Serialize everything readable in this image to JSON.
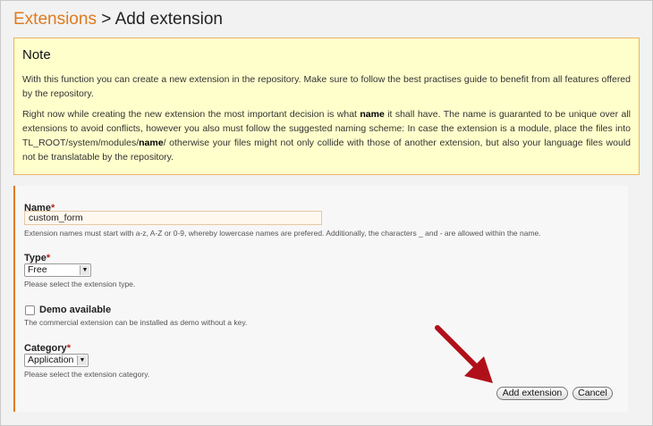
{
  "header": {
    "breadcrumb_link": "Extensions",
    "separator": ">",
    "title": "Add extension"
  },
  "note": {
    "heading": "Note",
    "p1": "With this function you can create a new extension in the repository. Make sure to follow the best practises guide to benefit from all features offered by the repository.",
    "p2_a": "Right now while creating the new extension the most important decision is what ",
    "p2_b": "name",
    "p2_c": " it shall have. The name is guaranted to be unique over all extensions to avoid conflicts, however you also must follow the suggested naming scheme: In case the extension is a module, place the files into TL_ROOT/system/modules/",
    "p2_d": "name",
    "p2_e": "/ otherwise your files might not only collide with those of another extension, but also your language files would not be translatable by the repository."
  },
  "form": {
    "name": {
      "label": "Name",
      "required_mark": "*",
      "value": "custom_form",
      "help": "Extension names must start with a-z, A-Z or 0-9, whereby lowercase names are prefered. Additionally, the characters _ and - are allowed within the name."
    },
    "type": {
      "label": "Type",
      "required_mark": "*",
      "selected": "Free",
      "help": "Please select the extension type."
    },
    "demo": {
      "label": "Demo available",
      "checked": false,
      "help": "The commercial extension can be installed as demo without a key."
    },
    "category": {
      "label": "Category",
      "required_mark": "*",
      "selected": "Application",
      "help": "Please select the extension category."
    },
    "buttons": {
      "submit": "Add extension",
      "cancel": "Cancel"
    }
  },
  "icons": {
    "dropdown": "chevron-down-icon",
    "pointer": "red-arrow-icon"
  },
  "colors": {
    "accent": "#e07a1e",
    "note_bg": "#ffffcc",
    "note_border": "#e8b36b",
    "required": "#c21e1e",
    "arrow": "#b0101a"
  }
}
